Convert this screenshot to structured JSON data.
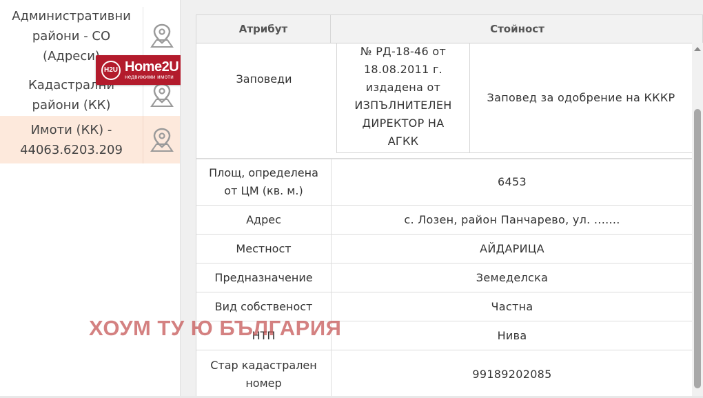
{
  "layers": [
    {
      "label": "Административни райони - СО (Адреси)",
      "icon": "map-pin-icon",
      "active": false
    },
    {
      "label": "Кадастрални райони (КК)",
      "icon": "map-pin-icon",
      "active": false
    },
    {
      "label": "Имоти (КК) - 44063.6203.209",
      "icon": "map-pin-icon",
      "active": true
    }
  ],
  "layer_labels": {
    "l0_line1": "Административни",
    "l0_line2": "райони - СО",
    "l0_line3": "(Адреси)",
    "l1_line1": "Кадастрални",
    "l1_line2": "райони (КК)",
    "l2_line1": "Имоти (КК) -",
    "l2_line2": "44063.6203.209"
  },
  "logo": {
    "mark": "H2U",
    "brand": "Home2U",
    "sub": "недвижими имоти"
  },
  "table": {
    "header_attribute": "Атрибут",
    "header_value": "Стойност",
    "order": {
      "attribute": "Заповеди",
      "number_lines": [
        "№ РД-18-46 от",
        "18.08.2011 г.",
        "издадена от",
        "ИЗПЪЛНИТЕЛЕН",
        "ДИРЕКТОР НА",
        "АГКК"
      ],
      "description": "Заповед за одобрение на КККР"
    },
    "rows": [
      {
        "attribute_lines": [
          "Площ, определена",
          "от ЦМ (кв. м.)"
        ],
        "value": "6453"
      },
      {
        "attribute_lines": [
          "Адрес"
        ],
        "value": "с. Лозен, район Панчарево, ул. ......."
      },
      {
        "attribute_lines": [
          "Местност"
        ],
        "value": "АЙДАРИЦА"
      },
      {
        "attribute_lines": [
          "Предназначение"
        ],
        "value": "Земеделска"
      },
      {
        "attribute_lines": [
          "Вид собственост"
        ],
        "value": "Частна"
      },
      {
        "attribute_lines": [
          "НТП"
        ],
        "value": "Нива"
      },
      {
        "attribute_lines": [
          "Стар кадастрален",
          "номер"
        ],
        "value": "99189202085"
      }
    ]
  },
  "watermark": "ХОУМ ТУ Ю БЪЛГАРИЯ",
  "colors": {
    "active_layer_bg": "#fde9dc",
    "logo_bg": "#b31b2c",
    "watermark": "#c45050"
  }
}
